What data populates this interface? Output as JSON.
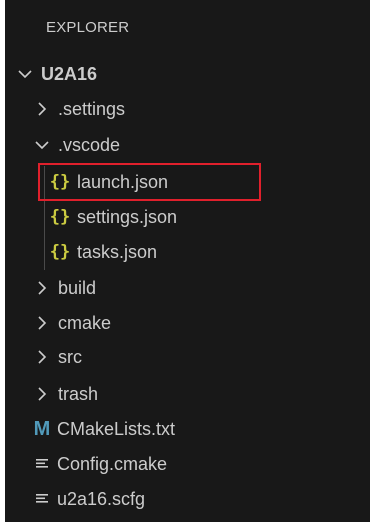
{
  "explorer": {
    "title": "EXPLORER",
    "root": {
      "label": "U2A16",
      "expanded": true
    },
    "items": [
      {
        "label": ".settings",
        "type": "folder",
        "expanded": false
      },
      {
        "label": ".vscode",
        "type": "folder",
        "expanded": true
      },
      {
        "label": "launch.json",
        "type": "json-file",
        "icon": "{}",
        "highlighted": true
      },
      {
        "label": "settings.json",
        "type": "json-file",
        "icon": "{}"
      },
      {
        "label": "tasks.json",
        "type": "json-file",
        "icon": "{}"
      },
      {
        "label": "build",
        "type": "folder",
        "expanded": false
      },
      {
        "label": "cmake",
        "type": "folder",
        "expanded": false
      },
      {
        "label": "src",
        "type": "folder",
        "expanded": false
      },
      {
        "label": "trash",
        "type": "folder",
        "expanded": false
      },
      {
        "label": "CMakeLists.txt",
        "type": "markdown-file",
        "icon": "M"
      },
      {
        "label": "Config.cmake",
        "type": "text-file",
        "icon": "lines-icon"
      },
      {
        "label": "u2a16.scfg",
        "type": "text-file",
        "icon": "lines-icon"
      }
    ]
  },
  "colors": {
    "background": "#181818",
    "text": "#cccccc",
    "json_icon": "#cbcb41",
    "markdown_icon": "#519aba",
    "highlight_border": "#e0202c"
  }
}
